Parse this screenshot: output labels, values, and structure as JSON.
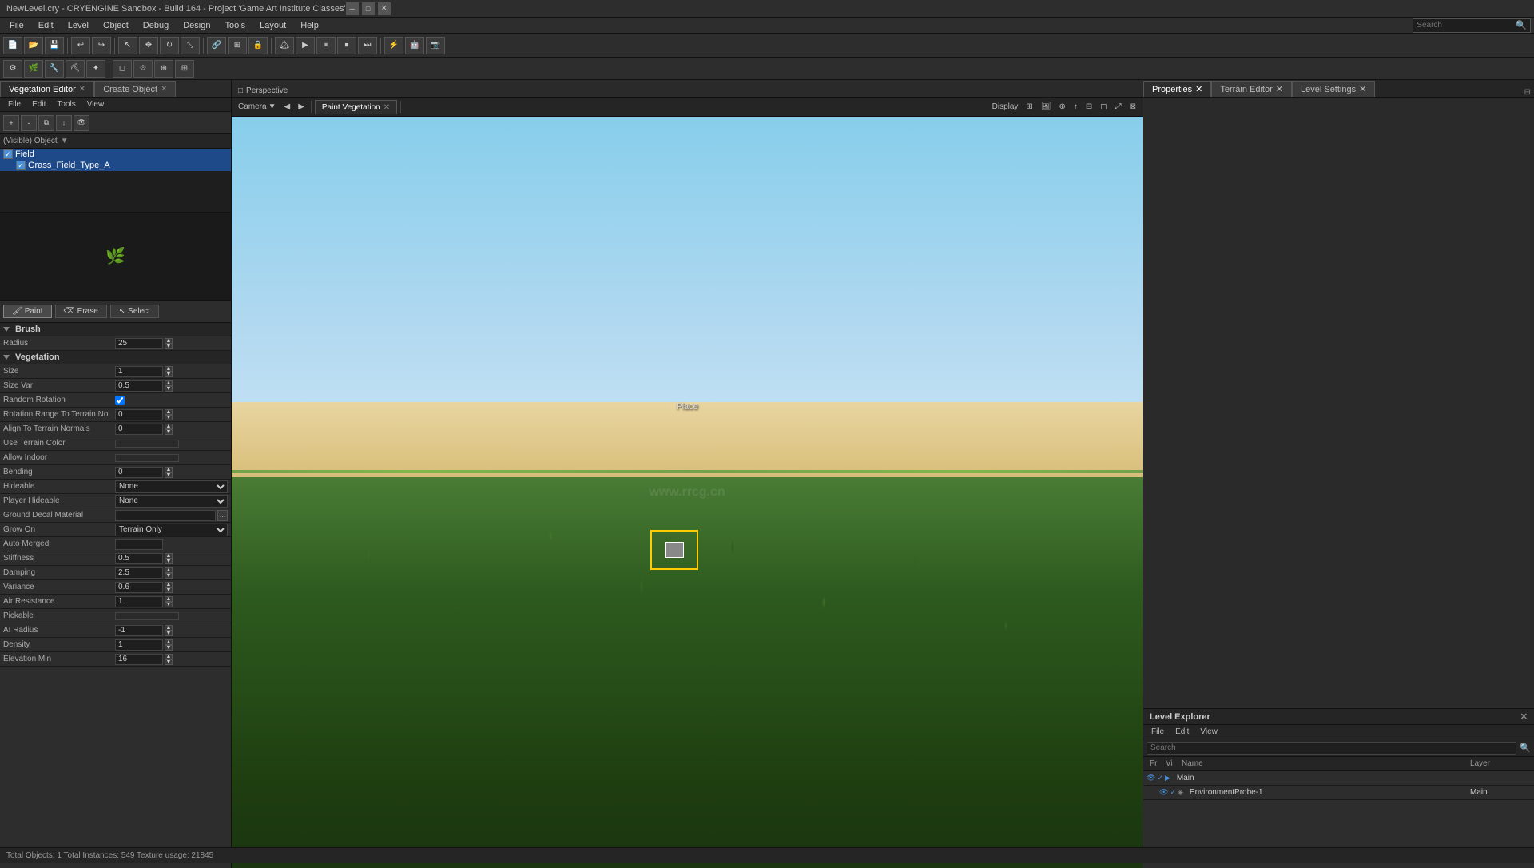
{
  "titlebar": {
    "text": "NewLevel.cry - CRYENGINE Sandbox - Build 164 - Project 'Game Art Institute Classes'",
    "minimize": "─",
    "maximize": "□",
    "close": "✕"
  },
  "menubar": {
    "items": [
      "File",
      "Edit",
      "Level",
      "Object",
      "Debug",
      "Design",
      "Tools",
      "Layout",
      "Help"
    ]
  },
  "vegEditor": {
    "title": "Vegetation Editor",
    "menus": [
      "File",
      "Edit",
      "Tools",
      "View"
    ],
    "objectHeader": "(Visible) Object",
    "treeItems": [
      {
        "label": "Field",
        "level": 0,
        "checked": true,
        "selected": true
      },
      {
        "label": "Grass_Field_Type_A",
        "level": 1,
        "checked": true,
        "selected": true
      }
    ],
    "paintTools": [
      "Paint",
      "Erase",
      "Select"
    ],
    "activeTool": "Paint",
    "brush": {
      "label": "Brush",
      "radius": {
        "label": "Radius",
        "value": "25"
      }
    },
    "vegetation": {
      "label": "Vegetation",
      "size": {
        "label": "Size",
        "value": "1"
      },
      "sizeVar": {
        "label": "Size Var",
        "value": "0.5"
      },
      "randomRotation": {
        "label": "Random Rotation",
        "checked": true
      },
      "rotationRangeToTerrainNormal": {
        "label": "Rotation Range To Terrain No.",
        "value": "0"
      },
      "alignToTerrainNormals": {
        "label": "Align To Terrain Normals",
        "value": "0"
      },
      "useTerrainColor": {
        "label": "Use Terrain Color",
        "value": ""
      },
      "allowIndoor": {
        "label": "Allow Indoor",
        "value": ""
      },
      "bending": {
        "label": "Bending",
        "value": "0"
      },
      "hideable": {
        "label": "Hideable",
        "value": "None"
      },
      "playerHideable": {
        "label": "Player Hideable",
        "value": "None"
      },
      "groundDecalMaterial": {
        "label": "Ground Decal Material",
        "value": ""
      },
      "growOn": {
        "label": "Grow On",
        "value": "Terrain Only"
      },
      "autoMerged": {
        "label": "Auto Merged",
        "value": ""
      },
      "stiffness": {
        "label": "Stiffness",
        "value": "0.5"
      },
      "damping": {
        "label": "Damping",
        "value": "2.5"
      },
      "variance": {
        "label": "Variance",
        "value": "0.6"
      },
      "airResistance": {
        "label": "Air Resistance",
        "value": "1"
      },
      "pickable": {
        "label": "Pickable",
        "value": ""
      },
      "aiRadius": {
        "label": "AI Radius",
        "value": "-1"
      },
      "density": {
        "label": "Density",
        "value": "1"
      },
      "elevationMin": {
        "label": "Elevation Min",
        "value": "16"
      }
    }
  },
  "viewport": {
    "label": "Perspective",
    "camera": "Camera",
    "paintLabel": "Paint Vegetation",
    "displayLabel": "Display",
    "placeText": "Place"
  },
  "rightPanel": {
    "tabs": [
      "Properties",
      "Terrain Editor",
      "Level Settings"
    ],
    "activeTab": "Properties"
  },
  "levelExplorer": {
    "title": "Level Explorer",
    "menus": [
      "File",
      "Edit",
      "View"
    ],
    "searchPlaceholder": "Search",
    "columns": [
      "Fr",
      "Vi",
      "Name",
      "",
      "Layer"
    ],
    "rows": [
      {
        "name": "Main",
        "layer": "",
        "icons": [
          "eye",
          "visible",
          "group"
        ]
      },
      {
        "name": "EnvironmentProbe-1",
        "layer": "Main",
        "icons": [
          "eye",
          "visible",
          "probe"
        ]
      }
    ]
  },
  "statusBar": {
    "text": "Total Objects: 1  Total Instances: 549  Texture usage: 21845"
  },
  "topSearch": {
    "placeholder": "Search",
    "label": "Search"
  }
}
